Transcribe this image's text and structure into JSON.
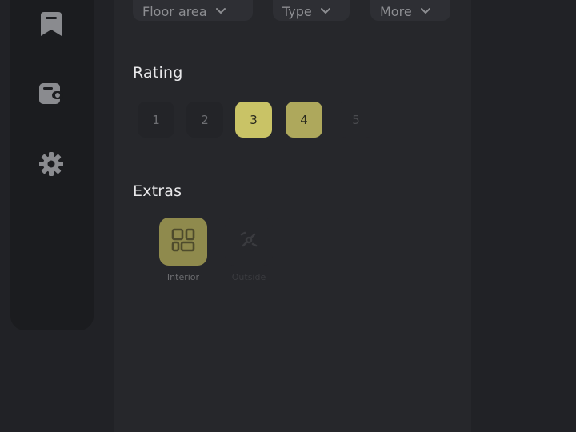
{
  "filters": {
    "floor_area": "Floor area",
    "type": "Type",
    "more": "More"
  },
  "sidebar": {
    "icons": [
      "bookmark-icon",
      "wallet-icon",
      "gear-icon"
    ]
  },
  "rating": {
    "title": "Rating",
    "options": [
      "1",
      "2",
      "3",
      "4",
      "5"
    ],
    "selected": [
      "3",
      "4"
    ]
  },
  "extras": {
    "title": "Extras",
    "items": [
      {
        "label": "Interior",
        "icon": "layout-grid-icon",
        "selected": true
      },
      {
        "label": "Outside",
        "icon": "outdoor-icon",
        "selected": false
      }
    ]
  },
  "colors": {
    "background": "#212226",
    "panel": "#26272b",
    "sidebar": "#1b1c1f",
    "accent": "#c9c366",
    "accent_muted": "#aea85c",
    "extra_selected": "#8f8a4d"
  }
}
